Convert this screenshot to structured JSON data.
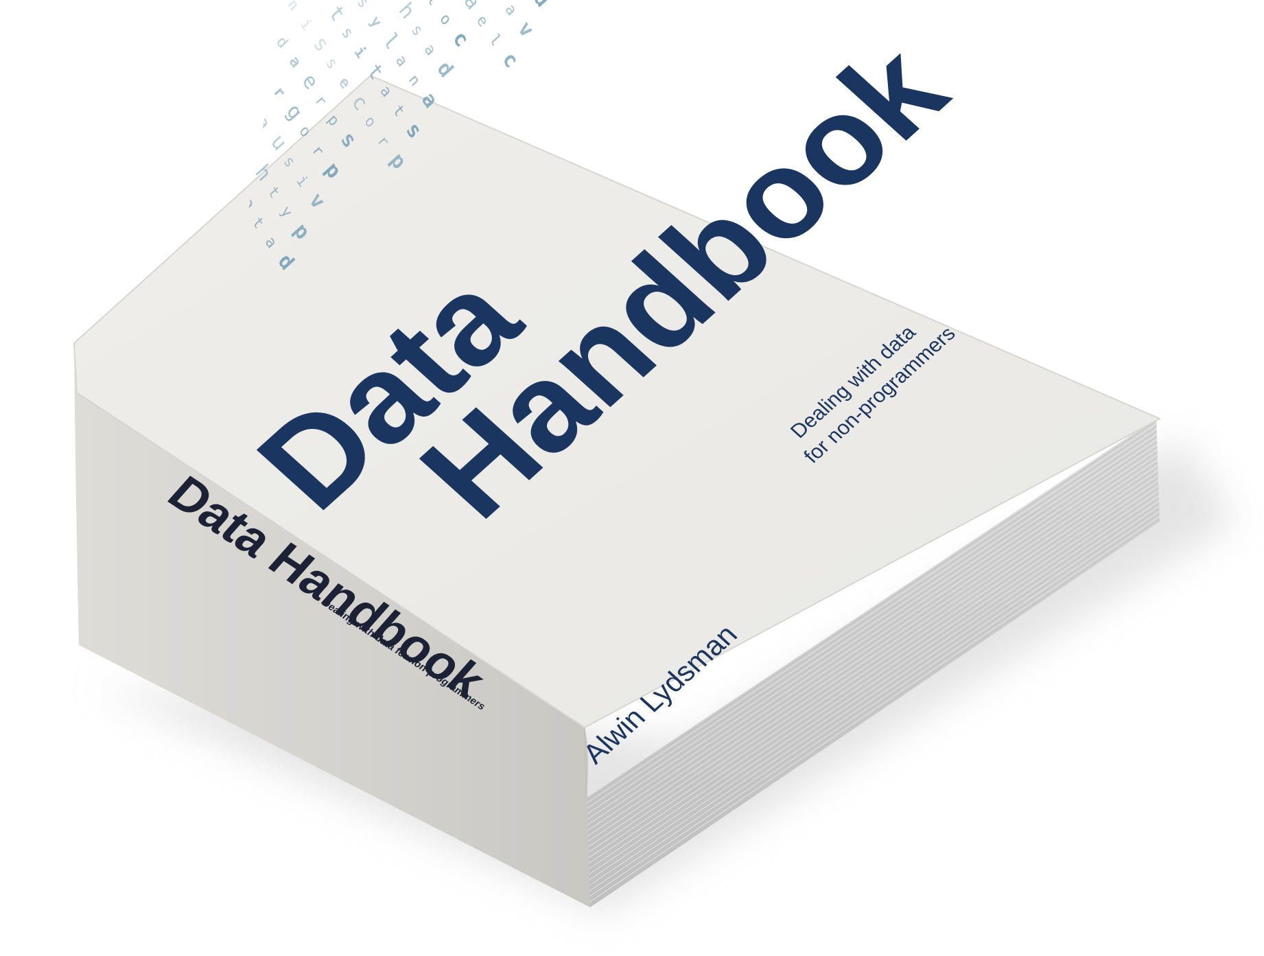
{
  "book": {
    "title_line1": "Data",
    "title_line2": "Handbook",
    "subtitle_line1": "Dealing with data",
    "subtitle_line2": "for non-programmers",
    "author": "Alwin Lydsman",
    "spine_title": "Data Handbook",
    "spine_subtitle": "Dealing with data for non-programmers"
  },
  "pattern": {
    "columns": [
      "data application",
      "python",
      "visualization",
      "programming",
      "spreadsheet",
      "processing",
      "statistics",
      "analysis",
      "dashboard",
      "collection",
      "cleaning",
      "variables",
      "databases",
      "integration",
      "computation",
      "numerical"
    ]
  },
  "colors": {
    "background": "#ffffff",
    "cover": "#ecebe7",
    "cover_edge": "#dcdad5",
    "spine": "#d4d2cd",
    "pages": "#cfcfcf",
    "ink": "#1b3561",
    "spine_ink": "#1c2235",
    "pattern_ink": "#6f9cb3",
    "shadow": "#d9d9d9"
  }
}
